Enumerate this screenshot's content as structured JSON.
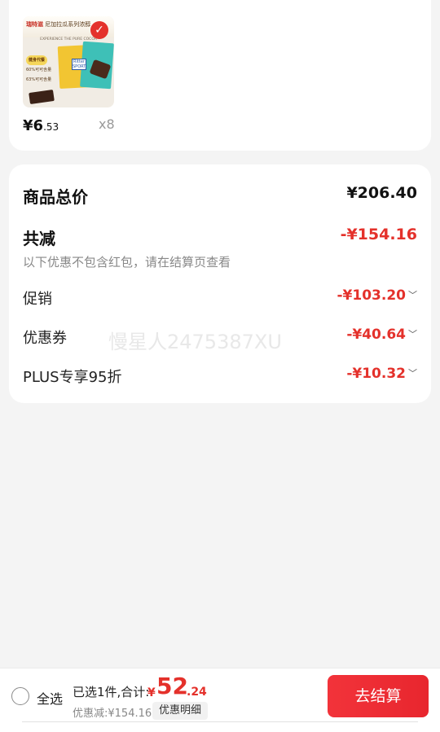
{
  "product": {
    "thumb_brand": "瑞特滋",
    "thumb_title": "尼加拉瓜系列浓醇",
    "thumb_sub": "EXPERIENCE THE PURE COCOA",
    "thumb_labels": [
      "健身代餐",
      "60%可可含量",
      "63%可可含量"
    ],
    "thumb_logo": "Ritter SPORT",
    "price_symbol": "¥",
    "price_int": "6",
    "price_dec": ".53",
    "qty": "x8",
    "check_icon": "check-icon"
  },
  "summary": {
    "total_label": "商品总价",
    "total_value": "¥206.40",
    "reduced_label": "共减",
    "reduced_value": "-¥154.16",
    "note": "以下优惠不包含红包，请在结算页查看",
    "items": [
      {
        "label": "促销",
        "value": "-¥103.20"
      },
      {
        "label": "优惠券",
        "value": "-¥40.64"
      },
      {
        "label": "PLUS专享95折",
        "value": "-¥10.32"
      }
    ],
    "chevron": "﹀"
  },
  "watermark": "慢星人2475387XU",
  "bottom": {
    "select_all": "全选",
    "selected_text": "已选1件,合计:",
    "total_symbol": "¥",
    "total_int": "52",
    "total_dec": ".24",
    "discount_text": "优惠减:¥154.16",
    "detail_button": "优惠明细",
    "checkout_button": "去结算"
  },
  "colors": {
    "accent": "#e4312b",
    "background": "#f4f4f4",
    "card": "#ffffff"
  }
}
